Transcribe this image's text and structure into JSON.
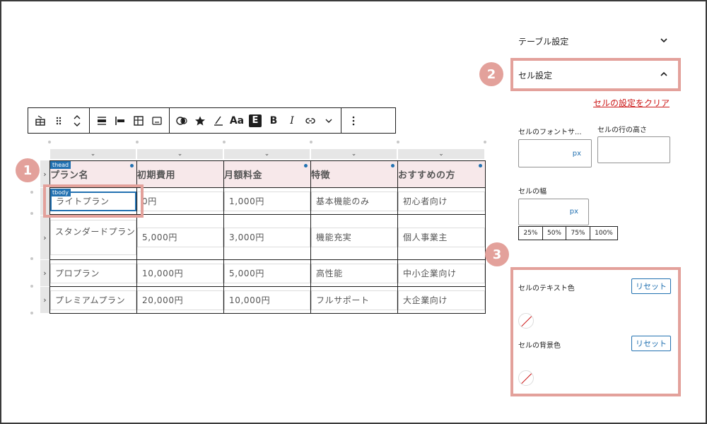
{
  "toolbar": {
    "buttons": [
      {
        "name": "table-block-icon"
      },
      {
        "name": "drag-handle-icon"
      },
      {
        "name": "move-up-down-icon"
      },
      {
        "name": "align-center-icon"
      },
      {
        "name": "align-left-icon"
      },
      {
        "name": "table-edit-icon"
      },
      {
        "name": "caption-icon"
      },
      {
        "name": "styles-icon"
      },
      {
        "name": "star-icon"
      },
      {
        "name": "highlight-icon"
      },
      {
        "name": "typography-icon",
        "label": "Aa"
      },
      {
        "name": "format-e-icon",
        "label": "E"
      },
      {
        "name": "bold-icon",
        "label": "B"
      },
      {
        "name": "italic-icon",
        "label": "I"
      },
      {
        "name": "link-icon"
      },
      {
        "name": "more-chevron-icon"
      },
      {
        "name": "options-kebab-icon"
      }
    ]
  },
  "table": {
    "thead_tag": "thead",
    "tbody_tag": "tbody",
    "headers": [
      "プラン名",
      "初期費用",
      "月額料金",
      "特徴",
      "おすすめの方"
    ],
    "rows": [
      [
        "ライトプラン",
        "0円",
        "1,000円",
        "基本機能のみ",
        "初心者向け"
      ],
      [
        "スタンダードプラン",
        "5,000円",
        "3,000円",
        "機能充実",
        "個人事業主"
      ],
      [
        "プロプラン",
        "10,000円",
        "5,000円",
        "高性能",
        "中小企業向け"
      ],
      [
        "プレミアムプラン",
        "20,000円",
        "10,000円",
        "フルサポート",
        "大企業向け"
      ]
    ]
  },
  "badges": [
    "1",
    "2",
    "3"
  ],
  "sidebar": {
    "table_settings": "テーブル設定",
    "cell_settings": "セル設定",
    "clear_link": "セルの設定をクリア",
    "font_size_label": "セルのフォントサ...",
    "row_height_label": "セルの行の高さ",
    "width_label": "セルの幅",
    "unit": "px",
    "percent_options": [
      "25%",
      "50%",
      "75%",
      "100%"
    ],
    "text_color_label": "セルのテキスト色",
    "bg_color_label": "セルの背景色",
    "reset_label": "リセット"
  },
  "colors": {
    "highlight": "#e3a19b",
    "accent": "#2271b1",
    "danger": "#cc1818",
    "header_bg": "#f7e8ea"
  }
}
